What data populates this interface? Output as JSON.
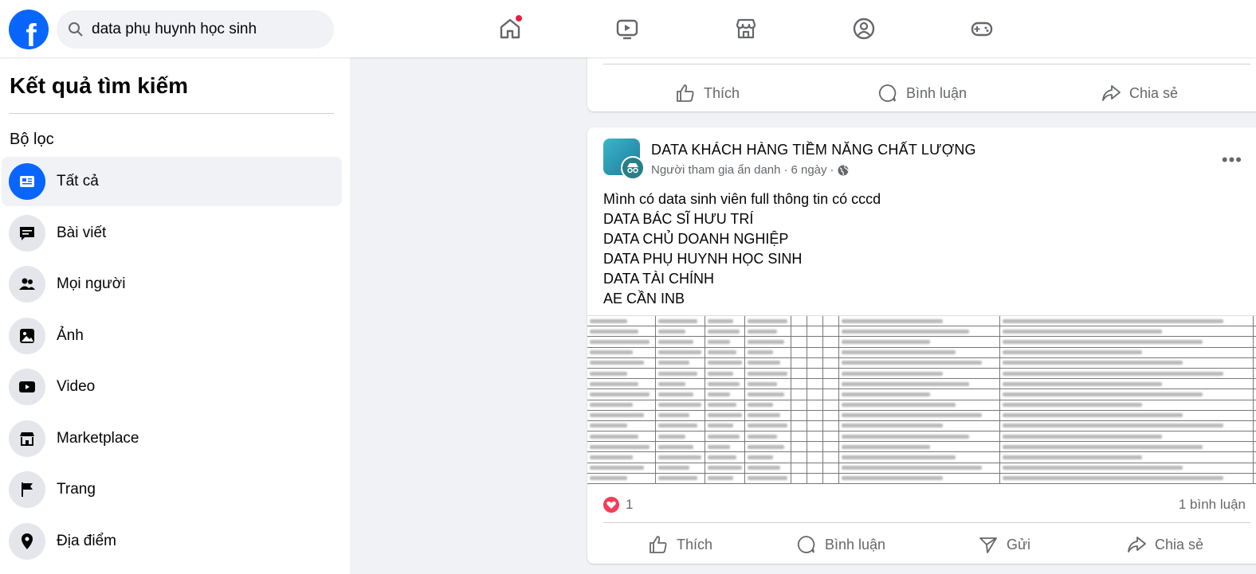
{
  "header": {
    "search_value": "data phụ huynh học sinh",
    "nav": [
      "home-icon",
      "video-icon",
      "marketplace-icon",
      "groups-icon",
      "gaming-icon"
    ],
    "accent": "#0866ff"
  },
  "sidebar": {
    "title": "Kết quả tìm kiếm",
    "filter_label": "Bộ lọc",
    "items": [
      {
        "label": "Tất cả",
        "icon": "feed-icon",
        "active": true
      },
      {
        "label": "Bài viết",
        "icon": "post-icon"
      },
      {
        "label": "Mọi người",
        "icon": "people-icon"
      },
      {
        "label": "Ảnh",
        "icon": "photo-icon"
      },
      {
        "label": "Video",
        "icon": "video-icon"
      },
      {
        "label": "Marketplace",
        "icon": "shop-icon"
      },
      {
        "label": "Trang",
        "icon": "flag-icon"
      },
      {
        "label": "Địa điểm",
        "icon": "location-icon"
      }
    ]
  },
  "prev_post": {
    "like": "Thích",
    "comment": "Bình luận",
    "share": "Chia sẻ"
  },
  "post": {
    "title": "DATA KHÁCH HÀNG TIỀM NĂNG CHẤT LƯỢNG",
    "author": "Người tham gia ẩn danh",
    "time": "6 ngày",
    "more": "•••",
    "body": "Mình có data sinh viên full thông tin có cccd\nDATA BÁC SĨ HƯU TRÍ\nDATA CHỦ DOANH NGHIỆP\nDATA PHỤ HUYNH HỌC SINH\nDATA TÀI CHÍNH\nAE CẦN INB",
    "image": "spreadsheet screenshot of personal data (redacted)",
    "reactions": "1",
    "comments": "1 bình luận",
    "like": "Thích",
    "comment": "Bình luận",
    "send": "Gửi",
    "share": "Chia sẻ"
  }
}
